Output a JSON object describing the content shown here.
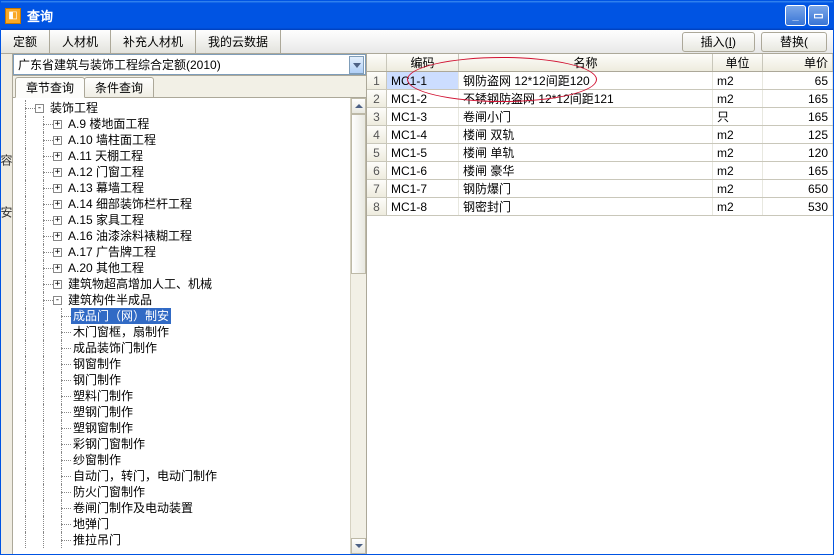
{
  "title": "查询",
  "toolbar_tabs": [
    "定额",
    "人材机",
    "补充人材机",
    "我的云数据"
  ],
  "right_buttons": {
    "insert": "插入(I)",
    "replace": "替换("
  },
  "combo_value": "广东省建筑与装饰工程综合定额(2010)",
  "subtabs": [
    "章节查询",
    "条件查询"
  ],
  "tree": [
    {
      "d": 0,
      "exp": "-",
      "label": "装饰工程"
    },
    {
      "d": 1,
      "exp": "+",
      "label": "A.9 楼地面工程"
    },
    {
      "d": 1,
      "exp": "+",
      "label": "A.10 墙柱面工程"
    },
    {
      "d": 1,
      "exp": "+",
      "label": "A.11 天棚工程"
    },
    {
      "d": 1,
      "exp": "+",
      "label": "A.12 门窗工程"
    },
    {
      "d": 1,
      "exp": "+",
      "label": "A.13 幕墙工程"
    },
    {
      "d": 1,
      "exp": "+",
      "label": "A.14 细部装饰栏杆工程"
    },
    {
      "d": 1,
      "exp": "+",
      "label": "A.15 家具工程"
    },
    {
      "d": 1,
      "exp": "+",
      "label": "A.16 油漆涂料裱糊工程"
    },
    {
      "d": 1,
      "exp": "+",
      "label": "A.17 广告牌工程"
    },
    {
      "d": 1,
      "exp": "+",
      "label": "A.20 其他工程"
    },
    {
      "d": 1,
      "exp": "+",
      "label": "建筑物超高增加人工、机械"
    },
    {
      "d": 1,
      "exp": "-",
      "label": "建筑构件半成品"
    },
    {
      "d": 2,
      "exp": "",
      "label": "成品门（网）制安",
      "sel": true
    },
    {
      "d": 2,
      "exp": "",
      "label": "木门窗框，扇制作"
    },
    {
      "d": 2,
      "exp": "",
      "label": "成品装饰门制作"
    },
    {
      "d": 2,
      "exp": "",
      "label": "钢窗制作"
    },
    {
      "d": 2,
      "exp": "",
      "label": "钢门制作"
    },
    {
      "d": 2,
      "exp": "",
      "label": "塑料门制作"
    },
    {
      "d": 2,
      "exp": "",
      "label": "塑钢门制作"
    },
    {
      "d": 2,
      "exp": "",
      "label": "塑钢窗制作"
    },
    {
      "d": 2,
      "exp": "",
      "label": "彩钢门窗制作"
    },
    {
      "d": 2,
      "exp": "",
      "label": "纱窗制作"
    },
    {
      "d": 2,
      "exp": "",
      "label": "自动门，转门，电动门制作"
    },
    {
      "d": 2,
      "exp": "",
      "label": "防火门窗制作"
    },
    {
      "d": 2,
      "exp": "",
      "label": "卷闸门制作及电动装置"
    },
    {
      "d": 2,
      "exp": "",
      "label": "地弹门"
    },
    {
      "d": 2,
      "exp": "",
      "label": "推拉吊门"
    }
  ],
  "grid_headers": {
    "code": "编码",
    "name": "名称",
    "unit": "单位",
    "price": "单价"
  },
  "grid_rows": [
    {
      "n": "1",
      "code": "MC1-1",
      "name": "钢防盗网 12*12间距120",
      "unit": "m2",
      "price": "65",
      "sel": true
    },
    {
      "n": "2",
      "code": "MC1-2",
      "name": "不锈钢防盗网 12*12间距121",
      "unit": "m2",
      "price": "165"
    },
    {
      "n": "3",
      "code": "MC1-3",
      "name": "卷闸小门",
      "unit": "只",
      "price": "165"
    },
    {
      "n": "4",
      "code": "MC1-4",
      "name": "楼闸 双轨",
      "unit": "m2",
      "price": "125"
    },
    {
      "n": "5",
      "code": "MC1-5",
      "name": "楼闸 单轨",
      "unit": "m2",
      "price": "120"
    },
    {
      "n": "6",
      "code": "MC1-6",
      "name": "楼闸 豪华",
      "unit": "m2",
      "price": "165"
    },
    {
      "n": "7",
      "code": "MC1-7",
      "name": "钢防爆门",
      "unit": "m2",
      "price": "650"
    },
    {
      "n": "8",
      "code": "MC1-8",
      "name": "钢密封门",
      "unit": "m2",
      "price": "530"
    }
  ],
  "side_labels": [
    "容",
    "安"
  ]
}
